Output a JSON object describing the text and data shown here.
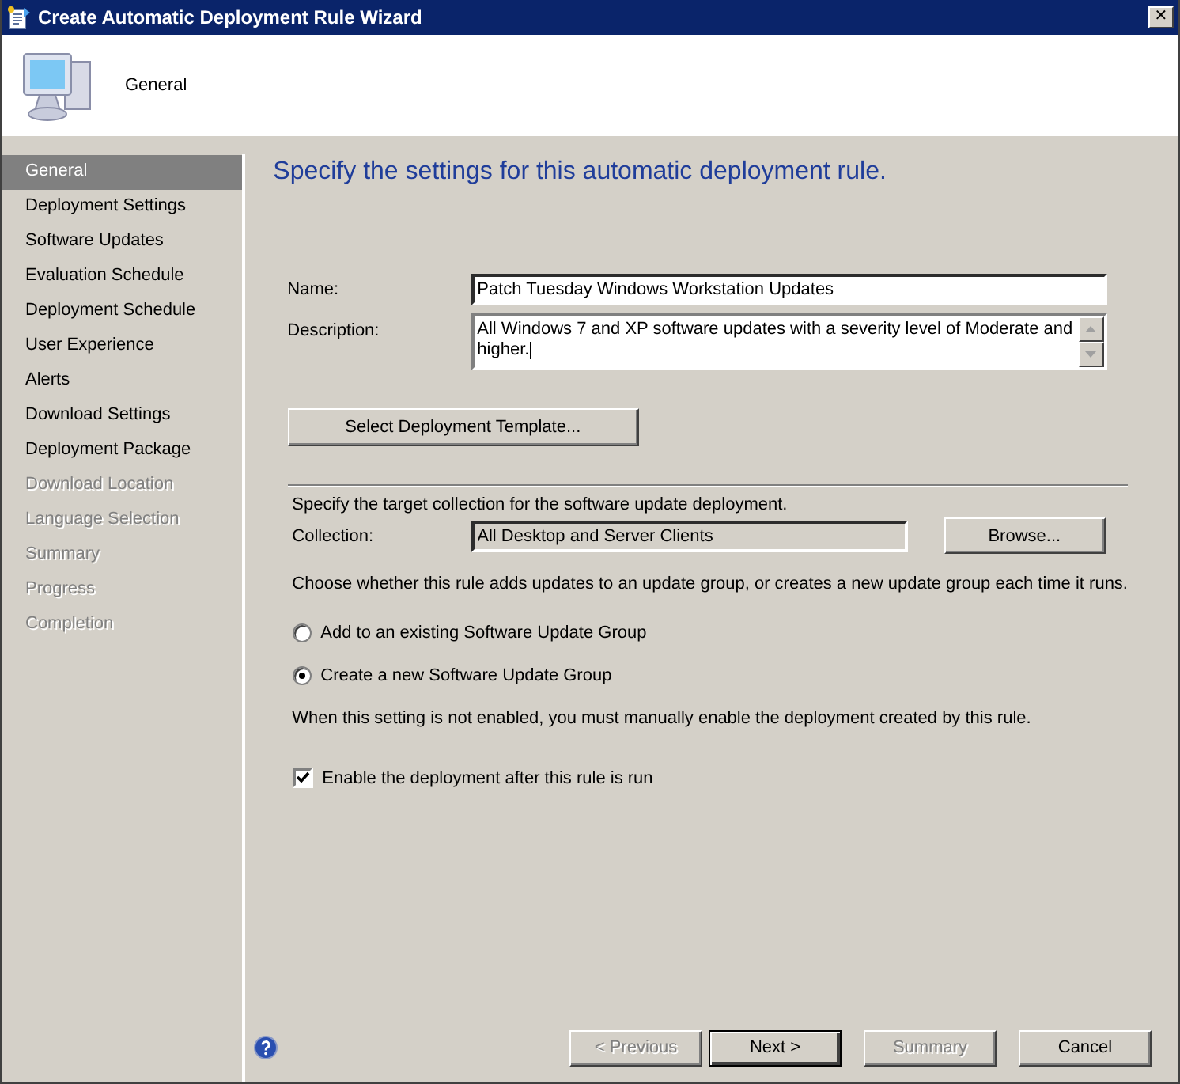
{
  "window": {
    "title": "Create Automatic Deployment Rule Wizard",
    "close": "✕"
  },
  "header": {
    "title": "General"
  },
  "sidebar": {
    "items": [
      {
        "label": "General",
        "selected": true,
        "disabled": false
      },
      {
        "label": "Deployment Settings",
        "selected": false,
        "disabled": false
      },
      {
        "label": "Software Updates",
        "selected": false,
        "disabled": false
      },
      {
        "label": "Evaluation Schedule",
        "selected": false,
        "disabled": false
      },
      {
        "label": "Deployment Schedule",
        "selected": false,
        "disabled": false
      },
      {
        "label": "User Experience",
        "selected": false,
        "disabled": false
      },
      {
        "label": "Alerts",
        "selected": false,
        "disabled": false
      },
      {
        "label": "Download Settings",
        "selected": false,
        "disabled": false
      },
      {
        "label": "Deployment Package",
        "selected": false,
        "disabled": false
      },
      {
        "label": "Download Location",
        "selected": false,
        "disabled": true
      },
      {
        "label": "Language Selection",
        "selected": false,
        "disabled": true
      },
      {
        "label": "Summary",
        "selected": false,
        "disabled": true
      },
      {
        "label": "Progress",
        "selected": false,
        "disabled": true
      },
      {
        "label": "Completion",
        "selected": false,
        "disabled": true
      }
    ]
  },
  "heading": "Specify  the settings for this automatic deployment rule.",
  "name": {
    "label": "Name:",
    "value": "Patch Tuesday Windows Workstation Updates"
  },
  "description": {
    "label": "Description:",
    "value": "All Windows 7 and XP software updates with a severity level of Moderate and higher."
  },
  "template_button": "Select Deployment Template...",
  "collection_intro": "Specify the target collection for the software update deployment.",
  "collection": {
    "label": "Collection:",
    "value": "All Desktop and Server Clients",
    "button": "Browse..."
  },
  "group_intro": "Choose whether this rule adds updates to an update group, or creates a new update group each time it runs.",
  "group_options": [
    {
      "label": "Add to an existing Software Update Group",
      "selected": false
    },
    {
      "label": "Create a new Software Update Group",
      "selected": true
    }
  ],
  "enable_note": "When this setting is not enabled, you must manually enable the deployment created by this rule.",
  "enable": {
    "label": "Enable the deployment after this rule is run",
    "checked": true
  },
  "footer": {
    "buttons": [
      {
        "label": "< Previous",
        "disabled": true,
        "default": false
      },
      {
        "label": "Next >",
        "disabled": false,
        "default": true
      },
      {
        "label": "Summary",
        "disabled": true,
        "default": false
      },
      {
        "label": "Cancel",
        "disabled": false,
        "default": false
      }
    ]
  }
}
